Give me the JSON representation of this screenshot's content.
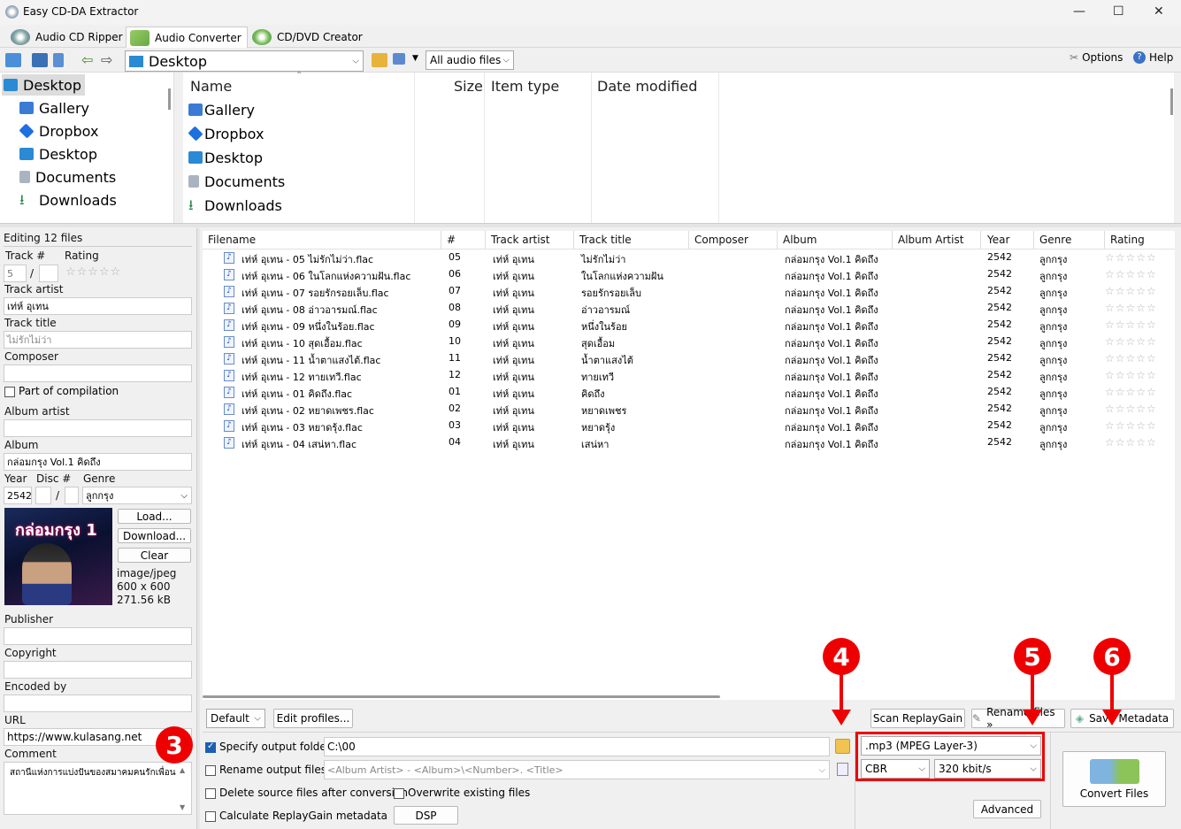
{
  "window": {
    "title": "Easy CD-DA Extractor",
    "minimize": "—",
    "maximize": "☐",
    "close": "✕"
  },
  "tabs": [
    {
      "label": "Audio CD Ripper"
    },
    {
      "label": "Audio Converter"
    },
    {
      "label": "CD/DVD Creator"
    }
  ],
  "toolbar": {
    "location": "Desktop",
    "filter": "All audio files",
    "options": "Options",
    "help": "Help"
  },
  "tree": [
    "Desktop",
    "Gallery",
    "Dropbox",
    "Desktop",
    "Documents",
    "Downloads"
  ],
  "filelist": {
    "columns": [
      "Name",
      "Size",
      "Item type",
      "Date modified"
    ],
    "items": [
      "Gallery",
      "Dropbox",
      "Desktop",
      "Documents",
      "Downloads"
    ]
  },
  "editor": {
    "editing": "Editing 12 files",
    "track_no_label": "Track #",
    "rating_label": "Rating",
    "track_no": "5",
    "track_slash": "/",
    "track_artist_label": "Track artist",
    "track_artist": "เท่ห์ อุเทน",
    "track_title_label": "Track title",
    "track_title": "ไม่รักไม่ว่า",
    "composer_label": "Composer",
    "compilation": "Part of compilation",
    "album_artist_label": "Album artist",
    "album_label": "Album",
    "album": "กล่อมกรุง Vol.1 คิดถึง",
    "year_label": "Year",
    "disc_label": "Disc #",
    "genre_label": "Genre",
    "year": "2542",
    "genre": "ลูกกรุง",
    "load": "Load...",
    "download": "Download...",
    "clear": "Clear",
    "cover_type": "image/jpeg",
    "cover_dims": "600 x 600",
    "cover_size": "271.56 kB",
    "cover_text": "กล่อมกรุง 1",
    "publisher_label": "Publisher",
    "copyright_label": "Copyright",
    "encoded_by_label": "Encoded by",
    "url_label": "URL",
    "url": "https://www.kulasang.net",
    "comment_label": "Comment",
    "comment": "สถานีแห่งการแบ่งปันของสมาคมคนรักเพื่อน"
  },
  "grid": {
    "columns": [
      "Filename",
      "#",
      "Track artist",
      "Track title",
      "Composer",
      "Album",
      "Album Artist",
      "Year",
      "Genre",
      "Rating"
    ],
    "rows": [
      {
        "file": "เท่ห์ อุเทน - 05 ไม่รักไม่ว่า.flac",
        "num": "05",
        "artist": "เท่ห์ อุเทน",
        "title": "ไม่รักไม่ว่า",
        "album": "กล่อมกรุง Vol.1 คิดถึง",
        "year": "2542",
        "genre": "ลูกกรุง"
      },
      {
        "file": "เท่ห์ อุเทน - 06 ในโลกแห่งความฝัน.flac",
        "num": "06",
        "artist": "เท่ห์ อุเทน",
        "title": "ในโลกแห่งความฝัน",
        "album": "กล่อมกรุง Vol.1 คิดถึง",
        "year": "2542",
        "genre": "ลูกกรุง"
      },
      {
        "file": "เท่ห์ อุเทน - 07 รอยรักรอยเล็บ.flac",
        "num": "07",
        "artist": "เท่ห์ อุเทน",
        "title": "รอยรักรอยเล็บ",
        "album": "กล่อมกรุง Vol.1 คิดถึง",
        "year": "2542",
        "genre": "ลูกกรุง"
      },
      {
        "file": "เท่ห์ อุเทน - 08 อ่าวอารมณ์.flac",
        "num": "08",
        "artist": "เท่ห์ อุเทน",
        "title": "อ่าวอารมณ์",
        "album": "กล่อมกรุง Vol.1 คิดถึง",
        "year": "2542",
        "genre": "ลูกกรุง"
      },
      {
        "file": "เท่ห์ อุเทน - 09 หนึ่งในร้อย.flac",
        "num": "09",
        "artist": "เท่ห์ อุเทน",
        "title": "หนึ่งในร้อย",
        "album": "กล่อมกรุง Vol.1 คิดถึง",
        "year": "2542",
        "genre": "ลูกกรุง"
      },
      {
        "file": "เท่ห์ อุเทน - 10 สุดเอื้อม.flac",
        "num": "10",
        "artist": "เท่ห์ อุเทน",
        "title": "สุดเอื้อม",
        "album": "กล่อมกรุง Vol.1 คิดถึง",
        "year": "2542",
        "genre": "ลูกกรุง"
      },
      {
        "file": "เท่ห์ อุเทน - 11 น้ำตาแสงไต้.flac",
        "num": "11",
        "artist": "เท่ห์ อุเทน",
        "title": "น้ำตาแสงไต้",
        "album": "กล่อมกรุง Vol.1 คิดถึง",
        "year": "2542",
        "genre": "ลูกกรุง"
      },
      {
        "file": "เท่ห์ อุเทน - 12 ทายเทวี.flac",
        "num": "12",
        "artist": "เท่ห์ อุเทน",
        "title": "ทายเทวี",
        "album": "กล่อมกรุง Vol.1 คิดถึง",
        "year": "2542",
        "genre": "ลูกกรุง"
      },
      {
        "file": "เท่ห์ อุเทน - 01 คิดถึง.flac",
        "num": "01",
        "artist": "เท่ห์ อุเทน",
        "title": "คิดถึง",
        "album": "กล่อมกรุง Vol.1 คิดถึง",
        "year": "2542",
        "genre": "ลูกกรุง"
      },
      {
        "file": "เท่ห์ อุเทน - 02 หยาดเพชร.flac",
        "num": "02",
        "artist": "เท่ห์ อุเทน",
        "title": "หยาดเพชร",
        "album": "กล่อมกรุง Vol.1 คิดถึง",
        "year": "2542",
        "genre": "ลูกกรุง"
      },
      {
        "file": "เท่ห์ อุเทน - 03 หยาดรุ้ง.flac",
        "num": "03",
        "artist": "เท่ห์ อุเทน",
        "title": "หยาดรุ้ง",
        "album": "กล่อมกรุง Vol.1 คิดถึง",
        "year": "2542",
        "genre": "ลูกกรุง"
      },
      {
        "file": "เท่ห์ อุเทน - 04 เสน่หา.flac",
        "num": "04",
        "artist": "เท่ห์ อุเทน",
        "title": "เสน่หา",
        "album": "กล่อมกรุง Vol.1 คิดถึง",
        "year": "2542",
        "genre": "ลูกกรุง"
      }
    ]
  },
  "converter": {
    "profile": "Default",
    "edit_profiles": "Edit profiles...",
    "scan_replaygain": "Scan ReplayGain",
    "rename_files": "Rename files »",
    "save_metadata": "Save Metadata",
    "specify_output": "Specify output folder",
    "output_folder": "C:\\00",
    "rename_output": "Rename output files",
    "rename_pattern": "<Album Artist> - <Album>\\<Number>. <Title>",
    "delete_source": "Delete source files after conversion",
    "overwrite": "Overwrite existing files",
    "calc_replaygain": "Calculate ReplayGain metadata",
    "dsp": "DSP",
    "format": ".mp3 (MPEG Layer-3)",
    "mode": "CBR",
    "bitrate": "320 kbit/s",
    "advanced": "Advanced",
    "convert": "Convert Files"
  },
  "annotations": {
    "b3": "3",
    "b4": "4",
    "b5": "5",
    "b6": "6"
  },
  "colors": {
    "highlight": "#e00000",
    "accent": "#1a5fb4"
  }
}
